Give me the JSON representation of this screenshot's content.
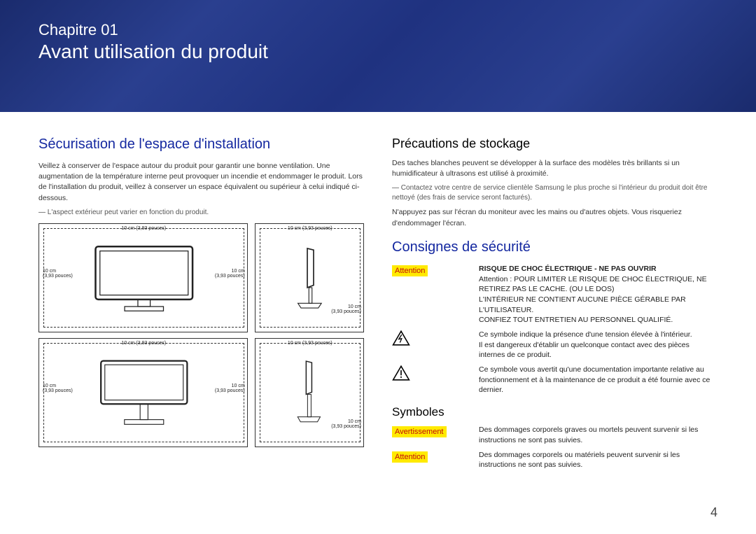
{
  "banner": {
    "chapter_label": "Chapitre 01",
    "chapter_title": "Avant utilisation du produit"
  },
  "page_number": "4",
  "left": {
    "h2": "Sécurisation de l'espace d'installation",
    "p1": "Veillez à conserver de l'espace autour du produit pour garantir une bonne ventilation. Une augmentation de la température interne peut provoquer un incendie et endommager le produit. Lors de l'installation du produit, veillez à conserver un espace équivalent ou supérieur à celui indiqué ci-dessous.",
    "note": "L'aspect extérieur peut varier en fonction du produit.",
    "top_label": "10 cm (3,93 pouces)",
    "left_label": "10 cm\n(3,93 pouces)",
    "right_label": "10 cm\n(3,93 pouces)",
    "bottom_label": "10 cm\n(3,93 pouces)"
  },
  "right": {
    "h2a": "Précautions de stockage",
    "p1": "Des taches blanches peuvent se développer à la surface des modèles très brillants si un humidificateur à ultrasons est utilisé à proximité.",
    "note1": "Contactez votre centre de service clientèle Samsung le plus proche si l'intérieur du produit doit être nettoyé (des frais de service seront facturés).",
    "p2": "N'appuyez pas sur l'écran du moniteur avec les mains ou d'autres objets. Vous risqueriez d'endommager l'écran.",
    "h2b": "Consignes de sécurité",
    "attention_tag": "Attention",
    "attn_row1": "RISQUE DE CHOC ÉLECTRIQUE - NE PAS OUVRIR",
    "attn_row2": "Attention : POUR LIMITER LE RISQUE DE CHOC ÉLECTRIQUE, NE RETIREZ PAS LE CACHE. (OU LE DOS)",
    "attn_row3": "L'INTÉRIEUR NE CONTIENT AUCUNE PIÈCE GÉRABLE PAR L'UTILISATEUR.",
    "attn_row4": "CONFIEZ TOUT ENTRETIEN AU PERSONNEL QUALIFIÉ.",
    "sym_voltage": "Ce symbole indique la présence d'une tension élevée à l'intérieur.",
    "sym_voltage2": "Il est dangereux d'établir un quelconque contact avec des pièces internes de ce produit.",
    "sym_doc": "Ce symbole vous avertit qu'une documentation importante relative au fonctionnement et à la maintenance de ce produit a été fournie avec ce dernier.",
    "h3_sym": "Symboles",
    "avert_tag": "Avertissement",
    "avert_text": "Des dommages corporels graves ou mortels peuvent survenir si les instructions ne sont pas suivies.",
    "attn2_tag": "Attention",
    "attn2_text": "Des dommages corporels ou matériels peuvent survenir si les instructions ne sont pas suivies."
  }
}
